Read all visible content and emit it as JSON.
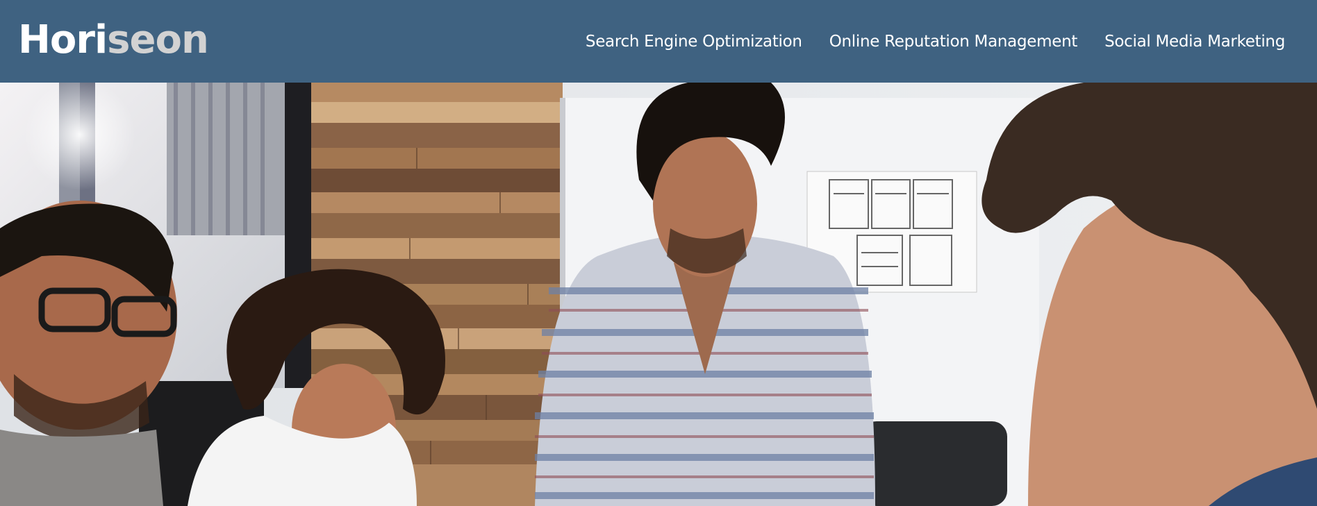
{
  "header": {
    "logo_part1": "Hori",
    "logo_part2": "seon",
    "background_color": "#3f6281"
  },
  "nav": {
    "items": [
      {
        "label": "Search Engine Optimization"
      },
      {
        "label": "Online Reputation Management"
      },
      {
        "label": "Social Media Marketing"
      }
    ]
  },
  "hero": {
    "image_semantic": "team-meeting-photo",
    "accent_colors": [
      "#3f6281",
      "#a87a54",
      "#e9ebee"
    ]
  }
}
